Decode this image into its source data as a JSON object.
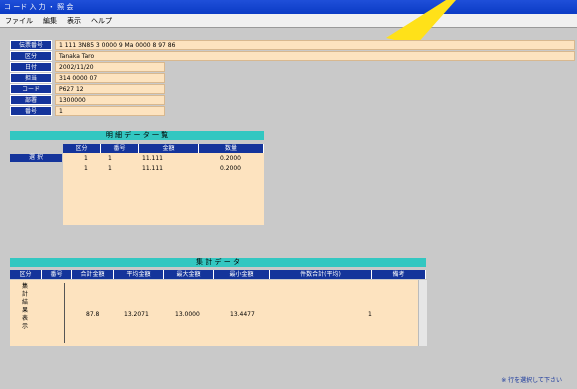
{
  "window": {
    "title": "コ ード 入 力 ・ 照 会"
  },
  "menu": [
    "ファイル",
    "編集",
    "表示",
    "ヘルプ"
  ],
  "fields": [
    {
      "label": "伝票番号",
      "value": "1 111 3N85 3 0000 9 Ma 0000 8 97 86"
    },
    {
      "label": "区分",
      "value": "Tanaka Taro"
    },
    {
      "label": "日付",
      "value": "2002/11/20"
    },
    {
      "label": "担当",
      "value": "314 0000 07"
    },
    {
      "label": "コード",
      "value": "P627 12"
    },
    {
      "label": "部署",
      "value": "1300000"
    },
    {
      "label": "番号",
      "value": "1"
    }
  ],
  "upper_table": {
    "title": "明 細 デ ー タ 一 覧",
    "row_tag": "選 択",
    "columns": [
      "区分",
      "番号",
      "金額",
      "数量"
    ],
    "rows": [
      [
        "1",
        "1",
        "11.111",
        "0.2000"
      ],
      [
        "1",
        "1",
        "11.111",
        "0.2000"
      ]
    ]
  },
  "lower_table": {
    "title": "集 計 デ ー タ",
    "columns": [
      "区分",
      "番号",
      "合計金額",
      "平均金額",
      "最大金額",
      "最小金額",
      "件数合計(平均)",
      "備考"
    ],
    "vertical_label": "集計結果表示",
    "row": [
      "87.8",
      "13.2071",
      "13.0000",
      "13.4477",
      "",
      "1"
    ]
  },
  "footer": {
    "text": "※ 行を選択して下さい"
  }
}
